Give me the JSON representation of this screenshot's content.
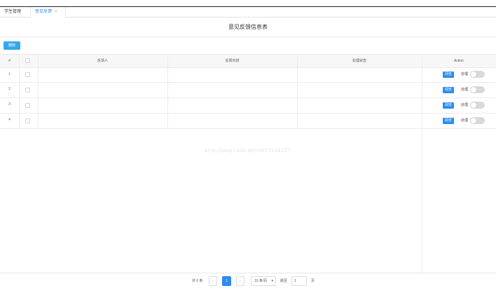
{
  "tabs": [
    {
      "label": "学生管理"
    },
    {
      "label": "意见反馈",
      "close": "×"
    }
  ],
  "page": {
    "title": "意见反馈信息表"
  },
  "toolbar": {
    "delete_label": "删除"
  },
  "table": {
    "columns": [
      "#",
      "反馈人",
      "反馈内容",
      "处理状态",
      "Action"
    ],
    "rows": [
      {
        "index": "1",
        "person": "",
        "content": "",
        "status": "",
        "view_label": "阅览",
        "handle_label": "处理",
        "handled": false
      },
      {
        "index": "2",
        "person": "",
        "content": "",
        "status": "",
        "view_label": "阅览",
        "handle_label": "处理",
        "handled": false
      },
      {
        "index": "3",
        "person": "",
        "content": "",
        "status": "",
        "view_label": "阅览",
        "handle_label": "处理",
        "handled": false
      },
      {
        "index": "4",
        "person": "",
        "content": "",
        "status": "",
        "view_label": "阅览",
        "handle_label": "处理",
        "handled": false
      }
    ]
  },
  "watermark": "http://blog.csdn.net/u013144287",
  "pagination": {
    "total_text": "共 0 条",
    "prev": "‹",
    "current_page": "1",
    "next": "›",
    "page_size": "10 条/页",
    "page_size_arrow": "▾",
    "jump_label": "跳至",
    "jump_value": "1",
    "page_unit": "页"
  },
  "colors": {
    "accent": "#2d8cf0",
    "delete_button": "#35a7ee",
    "toggle_off": "#d9d9d9"
  }
}
